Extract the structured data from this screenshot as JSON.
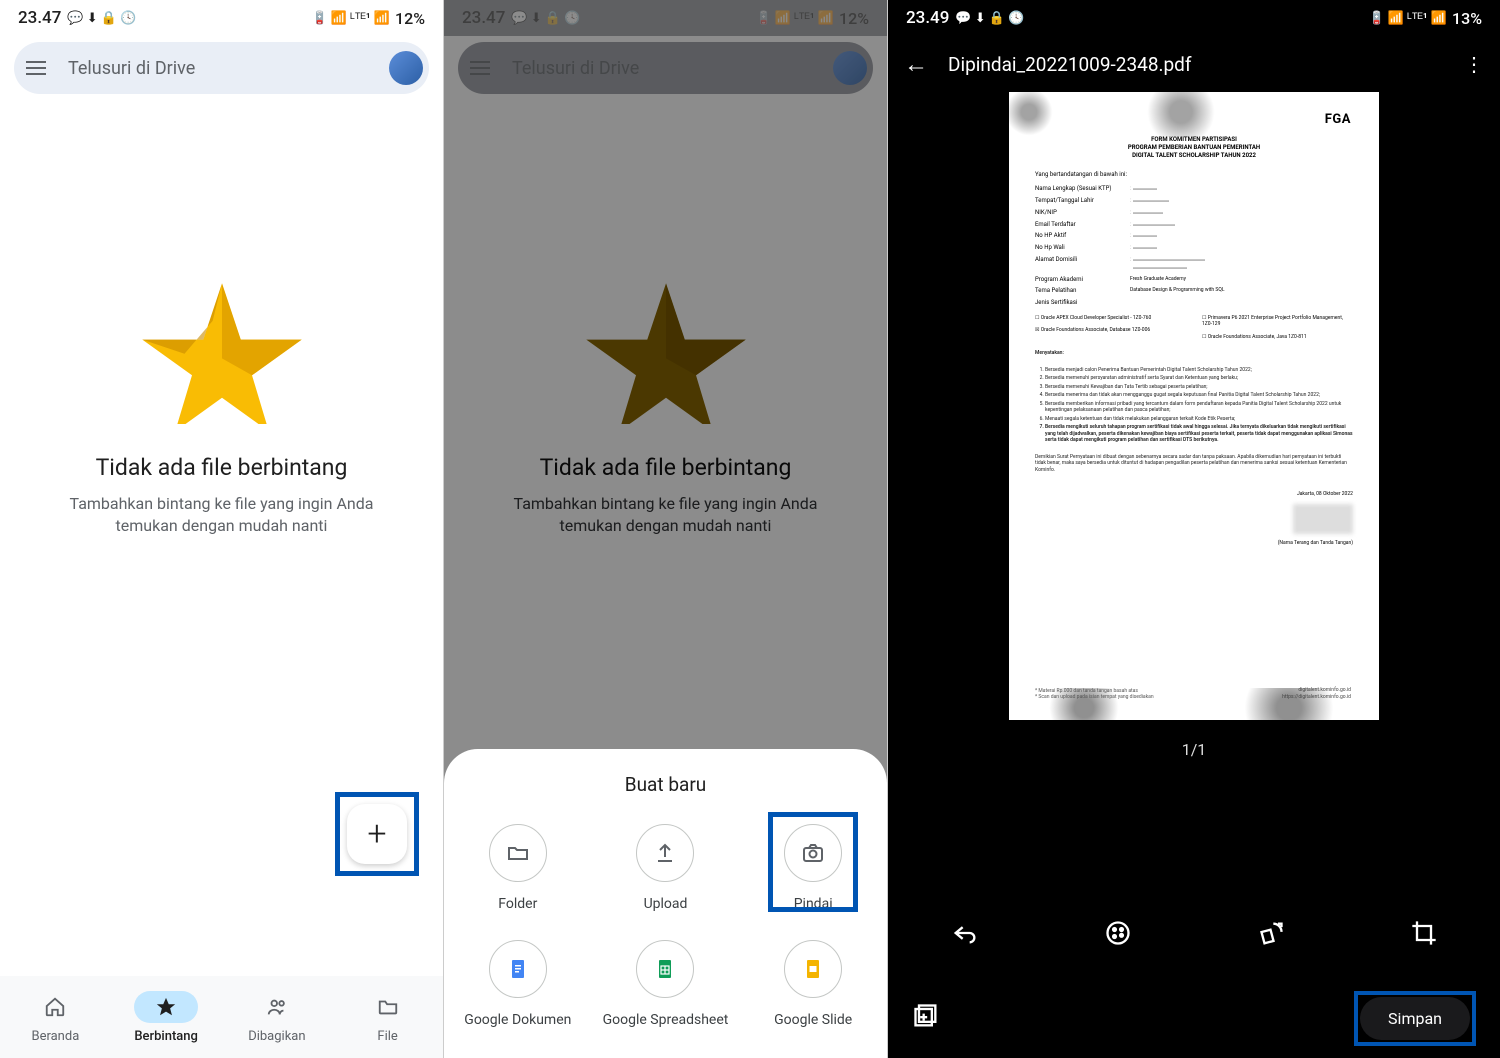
{
  "screen1": {
    "status": {
      "time": "23.47",
      "battery": "12%",
      "indicators": "💬 ⬇ 🔒 🕓",
      "right_icons": "🔋 📶 ᵛᵒᴮ ᴸᵀᴱ¹ 📶"
    },
    "search_placeholder": "Telusuri di Drive",
    "empty": {
      "title": "Tidak ada file berbintang",
      "desc": "Tambahkan bintang ke file yang ingin Anda temukan dengan mudah nanti"
    },
    "fab_plus": "+",
    "nav": [
      {
        "label": "Beranda"
      },
      {
        "label": "Berbintang"
      },
      {
        "label": "Dibagikan"
      },
      {
        "label": "File"
      }
    ]
  },
  "screen2": {
    "status": {
      "time": "23.47",
      "battery": "12%"
    },
    "search_placeholder": "Telusuri di Drive",
    "empty": {
      "title": "Tidak ada file berbintang",
      "desc": "Tambahkan bintang ke file yang ingin Anda temukan dengan mudah nanti"
    },
    "sheet": {
      "title": "Buat baru",
      "items": [
        {
          "label": "Folder"
        },
        {
          "label": "Upload"
        },
        {
          "label": "Pindai"
        },
        {
          "label": "Google Dokumen"
        },
        {
          "label": "Google Spreadsheet"
        },
        {
          "label": "Google Slide"
        }
      ]
    }
  },
  "screen3": {
    "status": {
      "time": "23.49",
      "battery": "13%"
    },
    "title": "Dipindai_20221009-2348.pdf",
    "page_indicator": "1/1",
    "save_label": "Simpan",
    "doc": {
      "logo": "FGA",
      "header": "FORM KOMITMEN PARTISIPASI\nPROGRAM PEMBERIAN BANTUAN PEMERINTAH\nDIGITAL TALENT SCHOLARSHIP TAHUN 2022",
      "intro": "Yang bertandatangan di bawah ini:",
      "fields": [
        {
          "label": "Nama Lengkap (Sesuai KTP)"
        },
        {
          "label": "Tempat/Tanggal Lahir"
        },
        {
          "label": "NIK/NIP"
        },
        {
          "label": "Email Terdaftar"
        },
        {
          "label": "No HP Aktif"
        },
        {
          "label": "No Hp Wali"
        },
        {
          "label": "Alamat Domisili"
        },
        {
          "label": "Program Akademi",
          "value": "Fresh Graduate Academy"
        },
        {
          "label": "Tema Pelatihan",
          "value": "Database Design & Programming with SQL"
        },
        {
          "label": "Jenis Sertifikasi"
        }
      ],
      "certs": [
        "☐ Oracle APEX Cloud Developer Specialist - 1Z0-760",
        "☐ Primavera P6 2021 Enterprise Project Portfolio Management, 1Z0-129",
        "☒ Oracle Foundations Associate, Database 1Z0-006",
        "☐ Oracle Foundations Associate, Java 1Z0-811"
      ],
      "menyatakan": "Menyatakan:",
      "points": [
        "Bersedia menjadi calon Penerima Bantuan Pemerintah Digital Talent Scholarship Tahun 2022;",
        "Bersedia memenuhi persyaratan administratif serta Syarat dan Ketentuan yang berlaku;",
        "Bersedia memenuhi Kewajiban dan Tata Tertib sebagai peserta pelatihan;",
        "Bersedia menerima dan tidak akan mengganggu gugat segala keputusan final Panitia Digital Talent Scholarship Tahun 2022;",
        "Bersedia memberikan informasi pribadi yang tercantum dalam form pendaftaran kepada Panitia Digital Talent Scholarship 2022 untuk kepentingan pelaksanaan pelatihan dan pasca pelatihan;",
        "Menaati segala ketentuan dan tidak melakukan pelanggaran terkait Kode Etik Peserta;",
        "Bersedia mengikuti seluruh tahapan program sertifikasi tidak awal hingga selesai. Jika ternyata dikeluarkan tidak mengikuti sertifikasi yang telah dijadwalkan, peserta dikenakan kewajiban biaya sertifikasi peserta terkait, peserta tidak dapat menggunakan aplikasi Simonas serta tidak dapat mengikuti program pelatihan dan sertifikasi DTS berikutnya."
      ],
      "closing": "Demikian Surat Pernyataan ini dibuat dengan sebenarnya secara sadar dan tanpa paksaan. Apabila dikemudian hari pernyataan ini terbukti tidak benar, maka saya bersedia untuk dituntut di hadapan pengadilan peserta pelatihan dan menerima sanksi sesuai ketentuan Kementerian Kominfo.",
      "date": "Jakarta, 08 Oktober 2022",
      "signature": "(Nama Terang dan Tanda Tangan)",
      "foot_left": "* Materai Rp.000 dan tanda tangan basah atas\n* Scan dan upload pada isian tempat yang disediakan",
      "foot_url": "digitalent.kominfo.go.id\nhttps://digitalent.kominfo.go.id"
    }
  }
}
